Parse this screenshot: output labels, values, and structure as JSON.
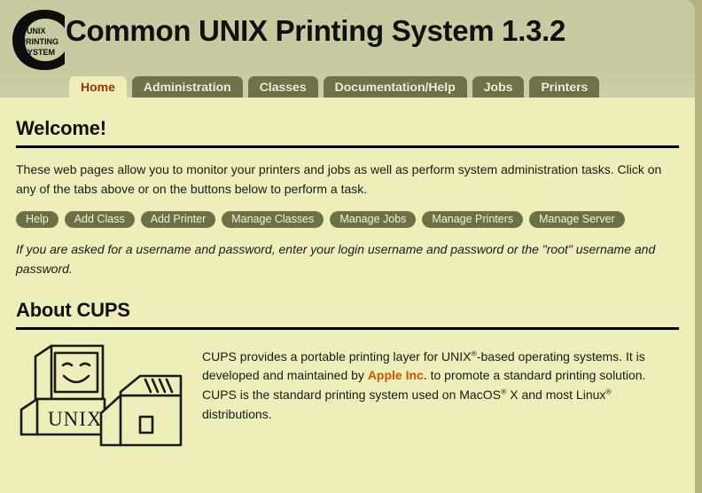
{
  "header": {
    "title": "Common UNIX Printing System 1.3.2",
    "logo": {
      "letter": "C",
      "line1": "UNIX",
      "line2": "PRINTING",
      "line3": "SYSTEM"
    }
  },
  "tabs": [
    {
      "label": "Home",
      "active": true
    },
    {
      "label": "Administration",
      "active": false
    },
    {
      "label": "Classes",
      "active": false
    },
    {
      "label": "Documentation/Help",
      "active": false
    },
    {
      "label": "Jobs",
      "active": false
    },
    {
      "label": "Printers",
      "active": false
    }
  ],
  "welcome": {
    "heading": "Welcome!",
    "paragraph": "These web pages allow you to monitor your printers and jobs as well as perform system administration tasks. Click on any of the tabs above or on the buttons below to perform a task.",
    "note": "If you are asked for a username and password, enter your login username and password or the \"root\" username and password."
  },
  "buttons": [
    {
      "label": "Help"
    },
    {
      "label": "Add Class"
    },
    {
      "label": "Add Printer"
    },
    {
      "label": "Manage Classes"
    },
    {
      "label": "Manage Jobs"
    },
    {
      "label": "Manage Printers"
    },
    {
      "label": "Manage Server"
    }
  ],
  "about": {
    "heading": "About CUPS",
    "illustration_label": "UNIX",
    "text": {
      "part1": "CUPS provides a portable printing layer for UNIX",
      "sup1": "®",
      "part2": "-based operating systems. It is developed and maintained by ",
      "link": "Apple Inc.",
      "part3": " to promote a standard printing solution. CUPS is the standard printing system used on MacOS",
      "sup2": "®",
      "part4": " X and most Linux",
      "sup3": "®",
      "part5": " distributions."
    }
  },
  "colors": {
    "page_background": "#b3b380",
    "header_background": "#c9caa2",
    "content_background": "#eeeeba",
    "tab_inactive": "#6f6f47",
    "tab_active_text": "#993300",
    "link": "#cc5500",
    "pill_background": "#6f6f47",
    "pill_text": "#f2f0d8"
  }
}
